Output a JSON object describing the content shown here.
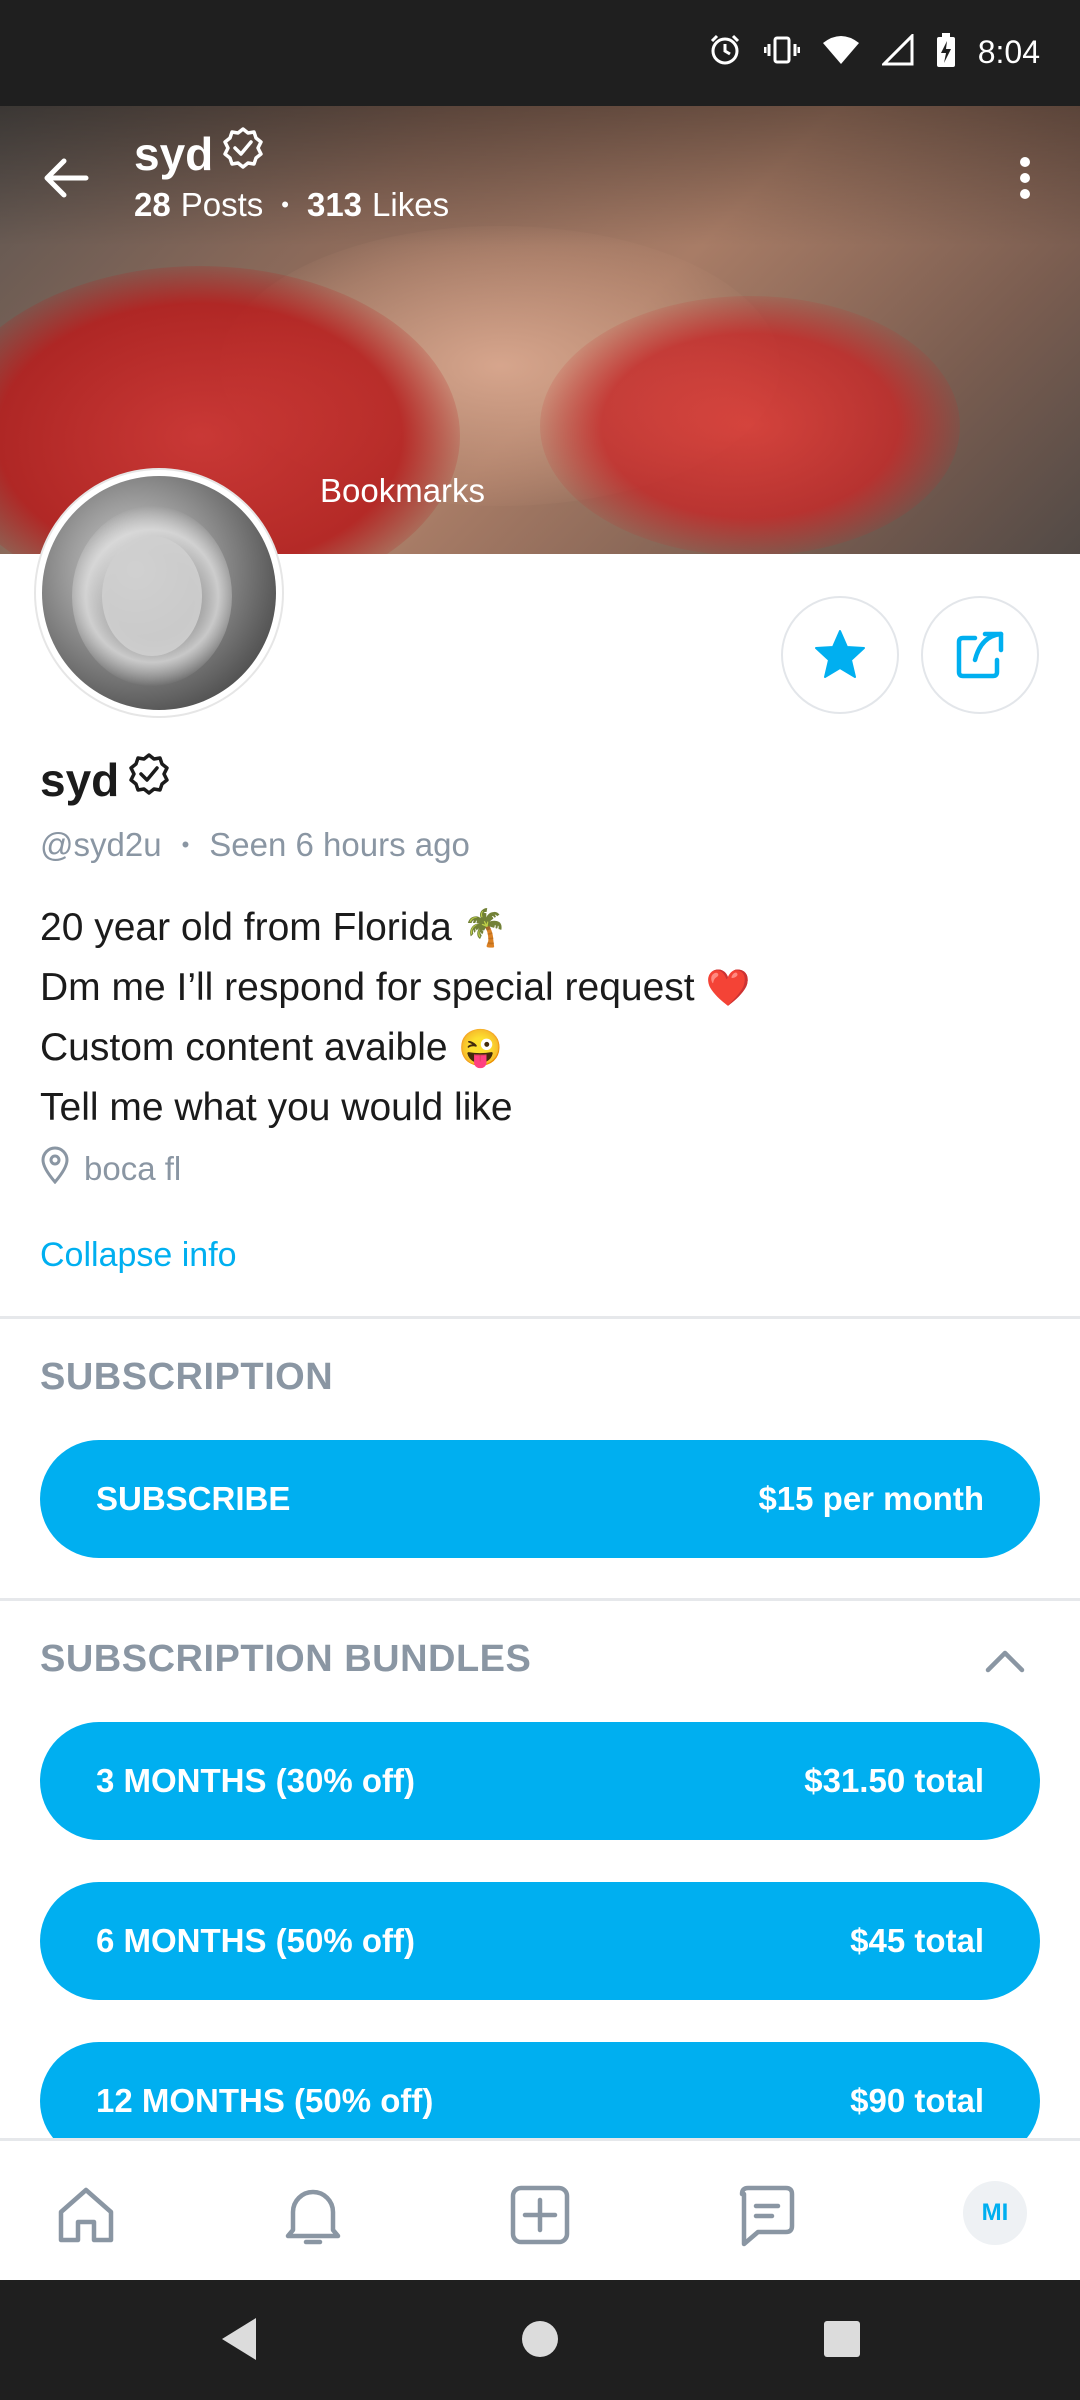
{
  "status_bar": {
    "time": "8:04",
    "icons": [
      "alarm-icon",
      "vibrate-icon",
      "wifi-icon",
      "signal-icon",
      "battery-charging-icon"
    ]
  },
  "header": {
    "name": "syd",
    "posts_count": "28",
    "posts_label": "Posts",
    "likes_count": "313",
    "likes_label": "Likes",
    "separator": "•",
    "bookmarks_label": "Bookmarks"
  },
  "profile": {
    "name": "syd",
    "handle": "@syd2u",
    "meta_separator": "•",
    "last_seen": "Seen 6 hours ago",
    "bio": {
      "line1": "20 year old from Florida",
      "line1_emoji": "🌴",
      "line2": "Dm me I’ll respond for special request",
      "line2_emoji": "❤️",
      "line3": "Custom content avaible",
      "line3_emoji": "😜",
      "line4": "Tell me what you would like"
    },
    "location": "boca fl",
    "collapse_label": "Collapse info"
  },
  "subscription": {
    "title": "SUBSCRIPTION",
    "button_label": "SUBSCRIBE",
    "button_price": "$15 per month"
  },
  "bundles": {
    "title": "SUBSCRIPTION BUNDLES",
    "items": [
      {
        "label": "3 MONTHS (30% off)",
        "price": "$31.50 total"
      },
      {
        "label": "6 MONTHS (50% off)",
        "price": "$45 total"
      },
      {
        "label": "12 MONTHS (50% off)",
        "price": "$90 total"
      }
    ]
  },
  "bottom_nav": {
    "avatar_initials": "MI"
  },
  "colors": {
    "accent": "#00aff0",
    "muted_text": "#8a96a3",
    "primary_text": "#1b1b1b",
    "divider": "#e6e8eb",
    "system_bar": "#1f1f1f"
  }
}
